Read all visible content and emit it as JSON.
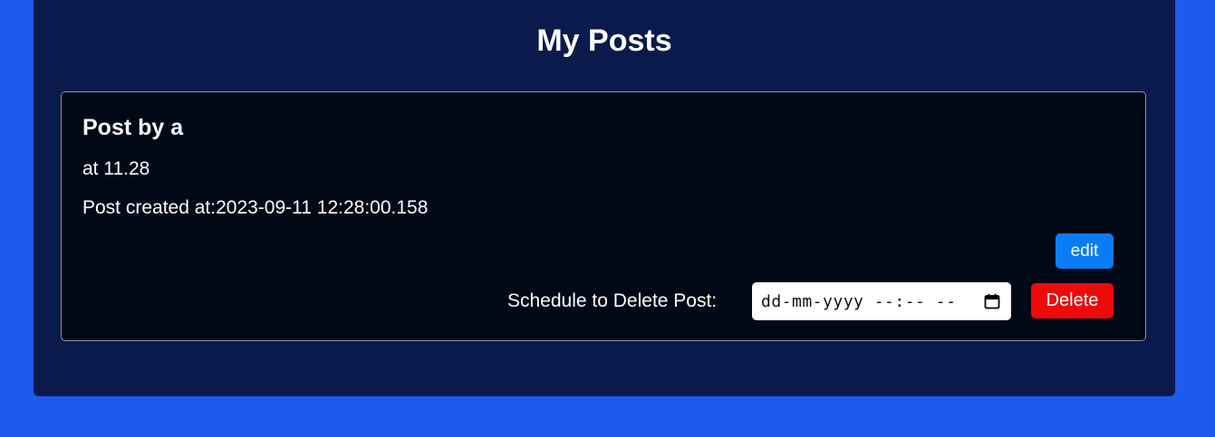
{
  "page": {
    "title": "My Posts"
  },
  "post": {
    "author_heading": "Post by a",
    "body": "at 11.28",
    "created_label": "Post created at:",
    "created_value": "2023-09-11 12:28:00.158",
    "edit_label": "edit",
    "schedule_label": "Schedule to Delete Post:",
    "date_placeholder": "dd-mm-yyyy --:-- --",
    "calendar_icon": "calendar-icon",
    "delete_label": "Delete"
  },
  "colors": {
    "background": "#1f5af0",
    "panel": "#0a1a4c",
    "card": "#010816",
    "edit_button": "#0a7cf5",
    "delete_button": "#ee0a0a"
  }
}
